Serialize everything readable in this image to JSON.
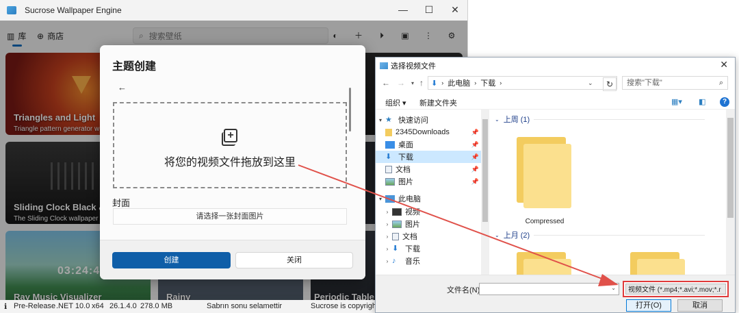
{
  "app": {
    "title": "Sucrose Wallpaper Engine",
    "window_controls": {
      "minimize": "—",
      "maximize": "☐",
      "close": "✕"
    },
    "nav": {
      "library": "库",
      "store": "商店"
    },
    "search_placeholder": "搜索壁纸",
    "cards": [
      {
        "title": "Triangles and Light",
        "subtitle": "Triangle pattern generator w"
      },
      {
        "title": "Sliding Clock Black &",
        "subtitle": "The Sliding Clock wallpaper c"
      },
      {
        "title": "Ray Music Visualizer",
        "subtitle": "",
        "clock": "03:24:4"
      },
      {
        "title": "Rainy",
        "subtitle": ""
      },
      {
        "title": "Periodic Table",
        "subtitle": ""
      }
    ],
    "status": {
      "release": "Pre-Release",
      "framework": ".NET 10.0",
      "arch": "x64",
      "version": "26.1.4.0",
      "memory": "278.0 MB",
      "message": "Sabrın sonu selamettir",
      "copyright": "Sucrose is copyright"
    }
  },
  "theme_dialog": {
    "title": "主题创建",
    "back": "←",
    "drop_text": "将您的视频文件拖放到这里",
    "cover_label": "封面",
    "cover_button": "请选择一张封面图片",
    "create_button": "创建",
    "close_button": "关闭"
  },
  "file_dialog": {
    "title": "选择视频文件",
    "close": "✕",
    "path": [
      "此电脑",
      "下载"
    ],
    "search_placeholder": "搜索\"下载\"",
    "toolbar": {
      "organize": "组织 ▾",
      "new_folder": "新建文件夹"
    },
    "tree": {
      "quick_access": "快速访问",
      "items": [
        "2345Downloads",
        "桌面",
        "下载",
        "文档",
        "图片"
      ],
      "this_pc": "此电脑",
      "pc_items": [
        "视频",
        "图片",
        "文档",
        "下载",
        "音乐"
      ]
    },
    "groups": {
      "last_week": "上周 (1)",
      "last_month": "上月 (2)"
    },
    "folder_name": "Compressed",
    "filename_label": "文件名(N):",
    "filetype": "视频文件 (*.mp4;*.avi;*.mov;*.r",
    "open_button": "打开(O)",
    "cancel_button": "取消"
  },
  "colors": {
    "accent": "#0f5ea8",
    "highlight": "#e03a3a",
    "folder": "#f3cc5f"
  }
}
